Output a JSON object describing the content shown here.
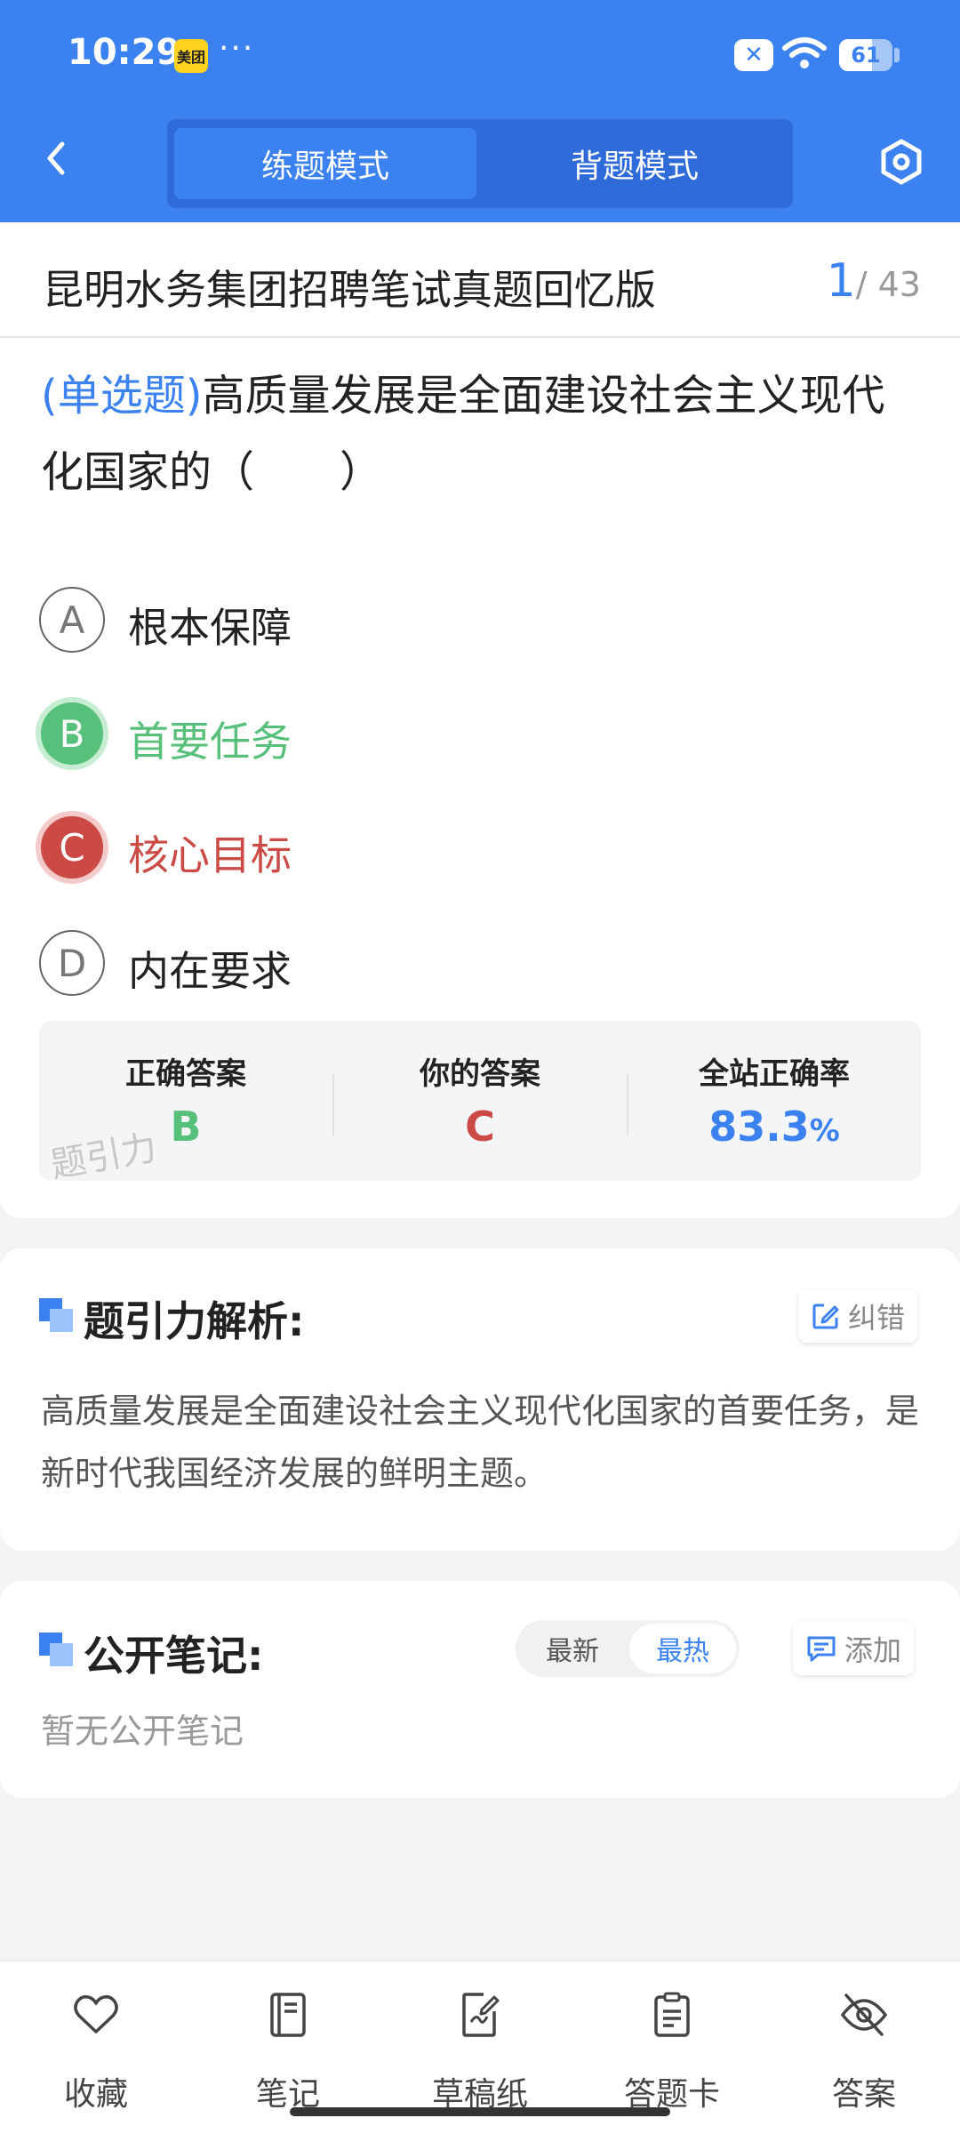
{
  "status_bar": {
    "time": "10:29",
    "app_badge": "美团",
    "dots": "···",
    "battery": "61",
    "battery_level": 0.61
  },
  "nav": {
    "tabs": [
      {
        "label": "练题模式",
        "active": true
      },
      {
        "label": "背题模式",
        "active": false
      }
    ]
  },
  "paper": {
    "title": "昆明水务集团招聘笔试真题回忆版",
    "current": "1",
    "total": "/ 43"
  },
  "question": {
    "type": "(单选题)",
    "text": "高质量发展是全面建设社会主义现代化国家的（　　）",
    "options": [
      {
        "letter": "A",
        "text": "根本保障",
        "state": "normal"
      },
      {
        "letter": "B",
        "text": "首要任务",
        "state": "correct"
      },
      {
        "letter": "C",
        "text": "核心目标",
        "state": "wrong"
      },
      {
        "letter": "D",
        "text": "内在要求",
        "state": "normal"
      }
    ]
  },
  "answer_summary": {
    "correct_label": "正确答案",
    "correct_value": "B",
    "yours_label": "你的答案",
    "yours_value": "C",
    "rate_label": "全站正确率",
    "rate_value": "83.3",
    "rate_unit": "%",
    "watermark": "题引力"
  },
  "analysis": {
    "title": "题引力解析:",
    "report_label": "纠错",
    "text": "高质量发展是全面建设社会主义现代化国家的首要任务，是新时代我国经济发展的鲜明主题。"
  },
  "notes": {
    "title": "公开笔记:",
    "sort_latest": "最新",
    "sort_hot": "最热",
    "add_label": "添加",
    "empty_text": "暂无公开笔记"
  },
  "bottom_tabs": [
    {
      "label": "收藏",
      "icon": "heart-icon"
    },
    {
      "label": "笔记",
      "icon": "notebook-icon"
    },
    {
      "label": "草稿纸",
      "icon": "draft-paper-icon"
    },
    {
      "label": "答题卡",
      "icon": "answer-sheet-icon"
    },
    {
      "label": "答案",
      "icon": "eye-off-icon"
    }
  ],
  "colors": {
    "primary": "#3b82f0",
    "correct": "#57c07a",
    "wrong": "#cc4a46"
  }
}
